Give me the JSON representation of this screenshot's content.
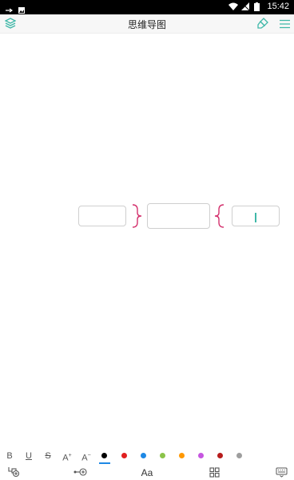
{
  "status_bar": {
    "time": "15:42",
    "icons": [
      "usb-icon",
      "image-icon",
      "wifi-icon",
      "signal-icon",
      "battery-icon"
    ]
  },
  "header": {
    "title": "思维导图",
    "left_icon": "layers-icon",
    "right_icons": [
      "paint-brush-icon",
      "menu-icon"
    ],
    "accent_color": "#3fb8a8"
  },
  "canvas": {
    "nodes": [
      {
        "name": "left-node",
        "text": ""
      },
      {
        "name": "center-node",
        "text": ""
      },
      {
        "name": "right-node",
        "text": "",
        "editing": true
      }
    ],
    "connector_color": "#d4326e"
  },
  "format_toolbar": {
    "bold": "B",
    "underline": "U",
    "strikethrough": "S",
    "increase_font": "A",
    "increase_sign": "+",
    "decrease_font": "A",
    "decrease_sign": "−",
    "colors": [
      "#000000",
      "#e02020",
      "#1e88e5",
      "#8bc34a",
      "#ff9800",
      "#c656e0",
      "#b71c1c",
      "#9e9e9e"
    ],
    "selected_color": "#000000"
  },
  "bottom_toolbar": {
    "text_style_label": "Aa",
    "icons": [
      "add-sibling-icon",
      "add-child-icon",
      "text-style-icon",
      "layout-grid-icon",
      "keyboard-icon"
    ]
  }
}
